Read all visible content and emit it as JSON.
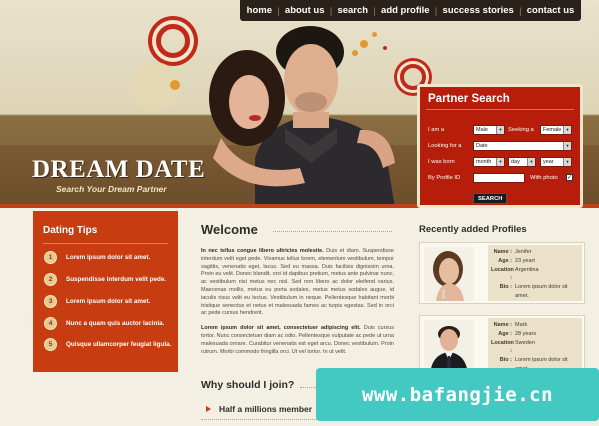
{
  "nav": {
    "items": [
      "home",
      "about us",
      "search",
      "add profile",
      "success stories",
      "contact us"
    ]
  },
  "logo": {
    "title": "DREAM DATE",
    "tagline": "Search Your Dream Partner"
  },
  "partner_search": {
    "title": "Partner Search",
    "i_am_label": "I am a",
    "i_am_value": "Male",
    "seeking_label": "Seeking a",
    "seeking_value": "Female",
    "looking_for_label": "Looking for a",
    "looking_for_value": "Date",
    "born_label": "I was born",
    "month_value": "month",
    "day_value": "day",
    "year_value": "year",
    "profile_id_label": "By Profile ID",
    "profile_id_value": "",
    "with_photo_label": "With photo",
    "with_photo_checked": true,
    "search_button": "SEARCH"
  },
  "tips": {
    "title": "Dating Tips",
    "items": [
      {
        "num": "1",
        "label": "Lorem ipsum dolor sit amet."
      },
      {
        "num": "2",
        "label": "Suspendisse interdum velit pede."
      },
      {
        "num": "3",
        "label": "Lorem ipsum dolor sit amet."
      },
      {
        "num": "4",
        "label": "Nunc a quam quis auctor lacinia."
      },
      {
        "num": "5",
        "label": "Quisque ullamcorper feugiat ligula."
      }
    ]
  },
  "welcome": {
    "title": "Welcome",
    "p1_lead": "In nec tellus congue libero ultricies molestie.",
    "p1_body": " Duis et diam. Suspendisse interdum velit eget pede. Vivamus tellus lorem, elementum vestibulum, tempor sagittis, venenatis eget, lacus. Sed eu massa. Duis facilisis dignissim urna. Proin eu velit. Donec blandit, orci id dapibus pretium, metus ante pulvinar nunc, ac vestibulum nisi metus nec nisl. Sed non libero ac dolor eleifend varius. Maecenas mollis, metus eu porta sodales, metus metus sodales augue, id iaculis risus velit eu lectus. Vestibulum in neque. Pellentesque habitant morbi tristique senectus et netus et malesuada fames ac turpis egestas. Sed in orci ac pede cursus hendrerit.",
    "p2_lead": "Lorem ipsum dolor sit amet, consectetuer adipiscing elit.",
    "p2_body": " Duis cursus tortor. Nunc consectetuer diam ac odio. Pellentesque vulputate ac pede ut urna malesuada ornare. Curabitur venenatis est eget arcu. Donec vestibulum. Proin rutrum. Morbi commodo fringilla orci. Ut vel tortor. In ut velit."
  },
  "why": {
    "title": "Why should I join?",
    "item": "Half a millions member"
  },
  "recent": {
    "title": "Recently added Profiles",
    "profiles": [
      {
        "name": "Jenifer",
        "age": "23 yeart",
        "location": "Argentina",
        "bio": "Lorem ipsum dolor sit amet."
      },
      {
        "name": "Mark",
        "age": "28 years",
        "location": "Sweden",
        "bio": "Lorem ipsum dolor sit amet."
      }
    ],
    "labels": {
      "name": "Name :",
      "age": "Age :",
      "location": "Location :",
      "bio": "Bio :"
    }
  },
  "watermark": {
    "text": "www.bafangjie.cn"
  },
  "colors": {
    "accent_red": "#b71d0b",
    "tips_orange": "#c73c11",
    "nav_dark": "#2a211a",
    "watermark_teal": "#44c9c2"
  }
}
